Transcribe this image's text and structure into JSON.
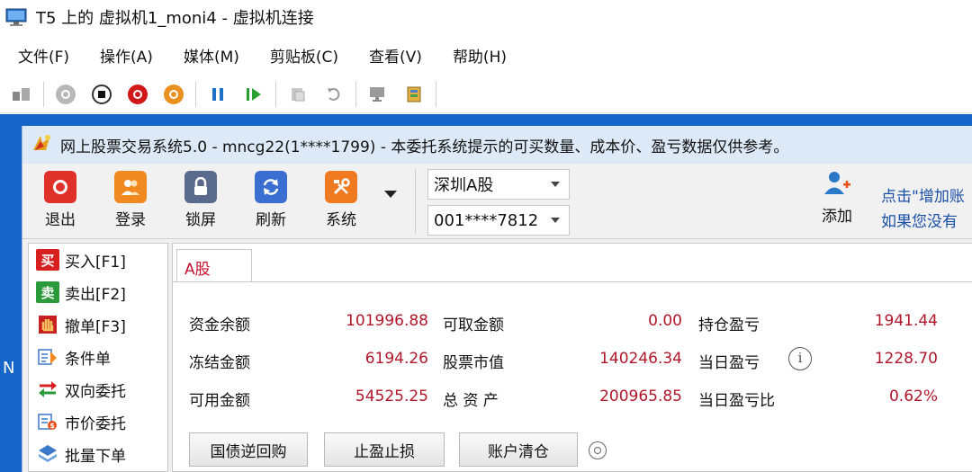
{
  "vm": {
    "title": "T5 上的 虚拟机1_moni4 - 虚拟机连接",
    "menu": [
      "文件(F)",
      "操作(A)",
      "媒体(M)",
      "剪贴板(C)",
      "查看(V)",
      "帮助(H)"
    ]
  },
  "desktop": {
    "edge_letter": "N"
  },
  "app": {
    "title": "网上股票交易系统5.0 - mncg22(1****1799) - 本委托系统提示的可买数量、成本价、盈亏数据仅供参考。",
    "toolbar": {
      "exit": "退出",
      "login": "登录",
      "lock": "锁屏",
      "refresh": "刷新",
      "system": "系统",
      "market_select": "深圳A股",
      "account_select": "001****7812",
      "add": "添加",
      "hint_line1": "点击\"增加账",
      "hint_line2": "如果您没有"
    },
    "nav": {
      "items": [
        {
          "glyph": "买",
          "label": "买入[F1]"
        },
        {
          "glyph": "卖",
          "label": "卖出[F2]"
        },
        {
          "glyph": "",
          "label": "撤单[F3]"
        },
        {
          "glyph": "",
          "label": "条件单"
        },
        {
          "glyph": "",
          "label": "双向委托"
        },
        {
          "glyph": "",
          "label": "市价委托"
        },
        {
          "glyph": "",
          "label": "批量下单"
        }
      ]
    },
    "tab": {
      "label": "A股"
    },
    "funds": {
      "row1": {
        "l1": "资金余额",
        "v1": "101996.88",
        "l2": "可取金额",
        "v2": "0.00",
        "l3": "持仓盈亏",
        "v3": "1941.44"
      },
      "row2": {
        "l1": "冻结金额",
        "v1": "6194.26",
        "l2": "股票市值",
        "v2": "140246.34",
        "l3": "当日盈亏",
        "v3": "1228.70",
        "info": "i"
      },
      "row3": {
        "l1": "可用金额",
        "v1": "54525.25",
        "l2": "总 资 产",
        "v2": "200965.85",
        "l3": "当日盈亏比",
        "v3": "0.62%"
      }
    },
    "actions": {
      "repo": "国债逆回购",
      "stop": "止盈止损",
      "clear": "账户清仓"
    }
  }
}
